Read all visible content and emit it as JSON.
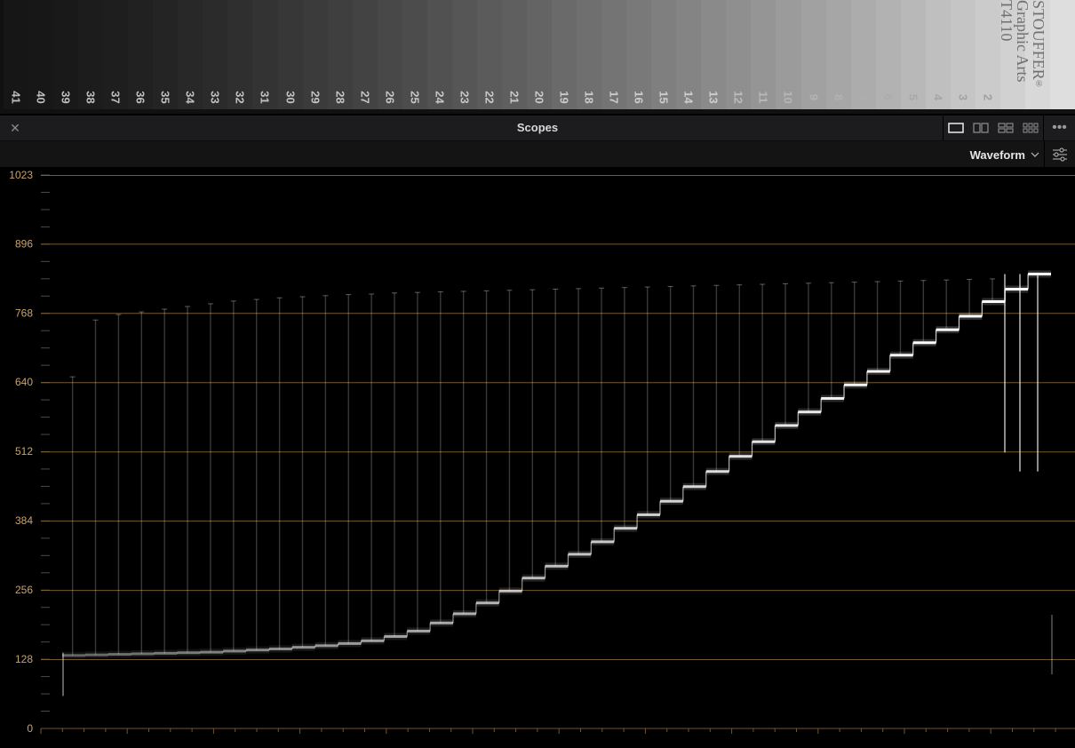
{
  "source_image": {
    "step_numbers": [
      "41",
      "40",
      "39",
      "38",
      "37",
      "36",
      "35",
      "34",
      "33",
      "32",
      "31",
      "30",
      "29",
      "28",
      "27",
      "26",
      "25",
      "24",
      "23",
      "22",
      "21",
      "20",
      "19",
      "18",
      "17",
      "16",
      "15",
      "14",
      "13",
      "12",
      "11",
      "10",
      "9",
      "8",
      "7",
      "6",
      "5",
      "4",
      "3",
      "2"
    ],
    "brand": {
      "name": "STOUFFER",
      "trademark": "®",
      "line2": "Graphic Arts",
      "line3": "T4110"
    }
  },
  "panel": {
    "title": "Scopes",
    "close_icon": "close-icon",
    "layout_icons": [
      "single-view-icon",
      "dual-view-icon",
      "quad-view-icon",
      "multi-view-icon"
    ],
    "more_icon": "more-options-icon",
    "mode": "Waveform",
    "settings_icon": "scope-settings-icon"
  },
  "colors": {
    "accent_gridline": "#8a6b3a",
    "label": "#c9a36a",
    "trace": "#ffffff"
  },
  "chart_data": {
    "type": "waveform",
    "y_axis": {
      "range": [
        0,
        1023
      ],
      "tick_labels": [
        "1023",
        "896",
        "768",
        "640",
        "512",
        "384",
        "256",
        "128",
        "0"
      ],
      "ticks": [
        1023,
        896,
        768,
        640,
        512,
        384,
        256,
        128,
        0
      ]
    },
    "grid": true,
    "series": [
      {
        "steps": [
          "41",
          "40",
          "39",
          "38",
          "37",
          "36",
          "35",
          "34",
          "33",
          "32",
          "31",
          "30",
          "29",
          "28",
          "27",
          "26",
          "25",
          "24",
          "23",
          "22",
          "21",
          "20",
          "19",
          "18",
          "17",
          "16",
          "15",
          "14",
          "13",
          "12",
          "11",
          "10",
          "9",
          "8",
          "7",
          "6",
          "5",
          "4",
          "3",
          "2"
        ],
        "values": [
          135,
          136,
          137,
          138,
          139,
          140,
          141,
          143,
          145,
          147,
          150,
          153,
          157,
          162,
          170,
          180,
          195,
          212,
          232,
          254,
          278,
          300,
          322,
          345,
          370,
          395,
          420,
          447,
          475,
          503,
          530,
          560,
          585,
          610,
          635,
          660,
          690,
          713,
          737,
          762,
          789,
          812,
          840
        ]
      },
      {
        "spike_peaks": [
          650,
          755,
          765,
          770,
          775,
          780,
          785,
          790,
          793,
          796,
          798,
          800,
          802,
          803,
          805,
          806,
          807,
          808,
          809,
          810,
          811,
          812,
          813,
          814,
          815,
          816,
          817,
          818,
          819,
          820,
          821,
          822,
          823,
          824,
          825,
          826,
          827,
          828,
          829,
          830,
          831
        ]
      }
    ]
  }
}
